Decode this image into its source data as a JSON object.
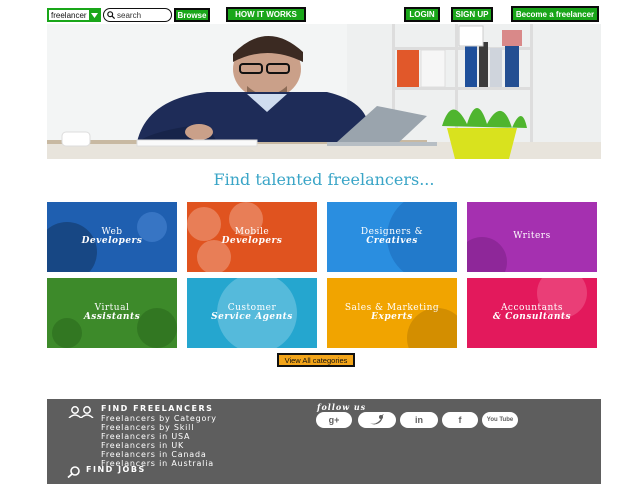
{
  "header": {
    "dropdown_value": "freelancer",
    "search_placeholder": "search",
    "browse_label": "Browse",
    "how_it_works_label": "HOW IT WORKS",
    "login_label": "LOGIN",
    "signup_label": "SIGN UP",
    "become_label": "Become a freelancer"
  },
  "hero": {
    "headline": "Find talented freelancers..."
  },
  "categories": [
    {
      "line1": "Web",
      "line2": "Developers",
      "color": "#1f5fb0"
    },
    {
      "line1": "Mobile",
      "line2": "Developers",
      "color": "#e0531f"
    },
    {
      "line1": "Designers &",
      "line2": "Creatives",
      "color": "#2a8ee0"
    },
    {
      "line1": "Writers",
      "line2": "",
      "color": "#a530b0"
    },
    {
      "line1": "Virtual",
      "line2": "Assistants",
      "color": "#3d8a2a"
    },
    {
      "line1": "Customer",
      "line2": "Service Agents",
      "color": "#25a6cf"
    },
    {
      "line1": "Sales & Marketing",
      "line2": "Experts",
      "color": "#f1a400"
    },
    {
      "line1": "Accountants",
      "line2": "& Consultants",
      "color": "#e3195c"
    }
  ],
  "view_all_label": "View All categories",
  "footer": {
    "find_freelancers_title": "FIND FREELANCERS",
    "links": [
      "Freelancers by Category",
      "Freelancers by Skill",
      "Freelancers in USA",
      "Freelancers in UK",
      "Freelancers in Canada",
      "Freelancers in Australia"
    ],
    "find_jobs_title": "FIND JOBS",
    "follow_label": "follow us",
    "social": [
      {
        "icon": "google-plus-icon",
        "glyph": "g+"
      },
      {
        "icon": "twitter-icon",
        "glyph": "🐦"
      },
      {
        "icon": "linkedin-icon",
        "glyph": "in"
      },
      {
        "icon": "facebook-icon",
        "glyph": "f"
      },
      {
        "icon": "youtube-icon",
        "glyph": "You Tube"
      }
    ]
  },
  "colors": {
    "accent_green": "#19a619",
    "headline_teal": "#3aa5c7",
    "footer_gray": "#5e5e5e",
    "view_all_orange": "#f3a51a"
  }
}
